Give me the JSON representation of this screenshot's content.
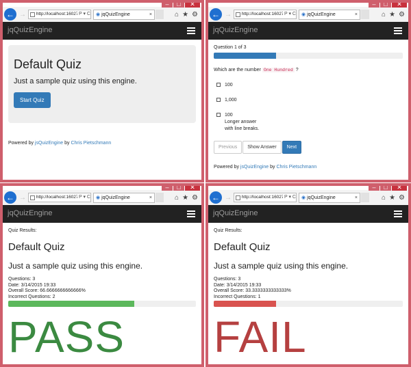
{
  "browser": {
    "url": "http://localhost:16027/",
    "tab_title": "jqQuizEngine",
    "address_tools": "P ▾ C"
  },
  "app": {
    "brand": "jqQuizEngine",
    "powered_prefix": "Powered by",
    "powered_link1": "jsQuizEngine",
    "powered_by": "by",
    "powered_link2": "Chris Pietschmann"
  },
  "quiz": {
    "title": "Default Quiz",
    "description": "Just a sample quiz using this engine.",
    "start_label": "Start Quiz"
  },
  "question": {
    "counter": "Question 1 of 3",
    "progress": 0.33,
    "text_before": "Which are the number",
    "code": "One Hundred",
    "text_after": "?",
    "answers": [
      {
        "lines": [
          "100"
        ]
      },
      {
        "lines": [
          "1,000"
        ]
      },
      {
        "lines": [
          "100",
          "Longer answer",
          "with line breaks."
        ]
      }
    ],
    "btn_previous": "Previous",
    "btn_show_answer": "Show Answer",
    "btn_next": "Next"
  },
  "results_pass": {
    "label": "Quiz Results:",
    "questions": "Questions: 3",
    "date": "Date: 3/14/2015 19:33",
    "score": "Overall Score: 66.6666666666666%",
    "incorrect": "Incorrect Questions: 2",
    "progress": 0.67,
    "bar_color": "#5cb85c",
    "verdict": "PASS",
    "verdict_color": "#3b8a41"
  },
  "results_fail": {
    "label": "Quiz Results:",
    "questions": "Questions: 3",
    "date": "Date: 3/14/2015 19:33",
    "score": "Overall Score: 33.3333333333333%",
    "incorrect": "Incorrect Questions: 1",
    "progress": 0.33,
    "bar_color": "#d9534f",
    "verdict": "FAIL",
    "verdict_color": "#b54040"
  },
  "colors": {
    "window_border": "#cf5f6c",
    "primary": "#337ab7",
    "navbar": "#222222"
  },
  "icons": [
    "back-icon",
    "forward-icon",
    "home-icon",
    "favorites-icon",
    "settings-icon",
    "menu-icon"
  ]
}
